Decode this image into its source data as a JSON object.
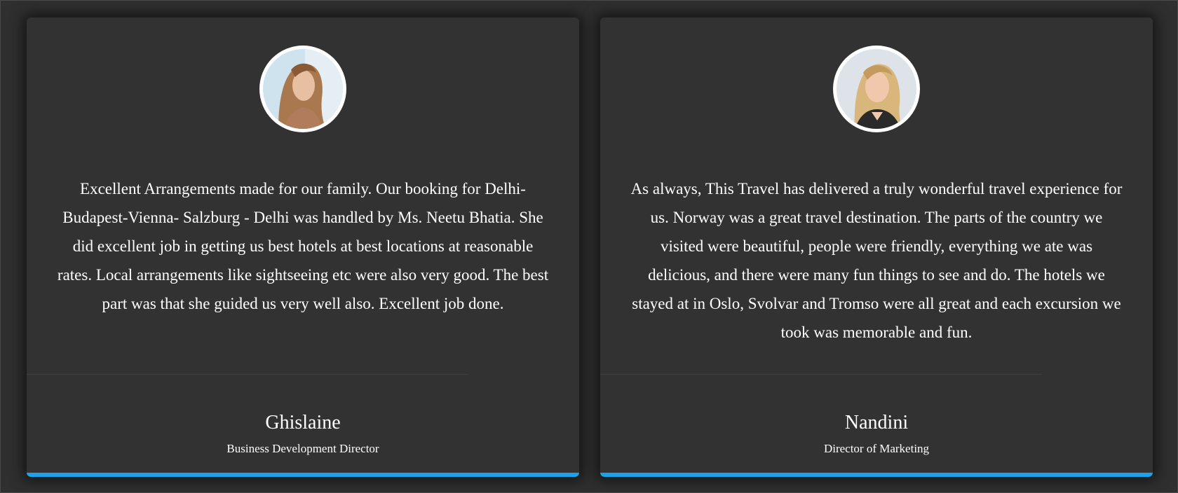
{
  "colors": {
    "background": "#2f2f2f",
    "card": "#323232",
    "accent": "#1aa3e8",
    "text": "#ffffff"
  },
  "testimonials": [
    {
      "avatar_icon": "person-photo",
      "quote": "Excellent Arrangements made for our family. Our booking for Delhi-Budapest-Vienna- Salzburg - Delhi was handled by Ms. Neetu Bhatia. She did excellent job in getting us best hotels at best locations at reasonable rates. Local arrangements like sightseeing etc were also very good. The best part was that she guided us very well also. Excellent job done.",
      "name": "Ghislaine",
      "role": "Business Development Director"
    },
    {
      "avatar_icon": "person-photo",
      "quote": "As always, This Travel has delivered a truly wonderful travel experience for us. Norway was a great travel destination. The parts of the country we visited were beautiful, people were friendly, everything we ate was delicious, and there were many fun things to see and do. The hotels we stayed at in Oslo, Svolvar and Tromso were all great and each excursion we took was memorable and fun.",
      "name": "Nandini",
      "role": "Director of Marketing"
    }
  ]
}
